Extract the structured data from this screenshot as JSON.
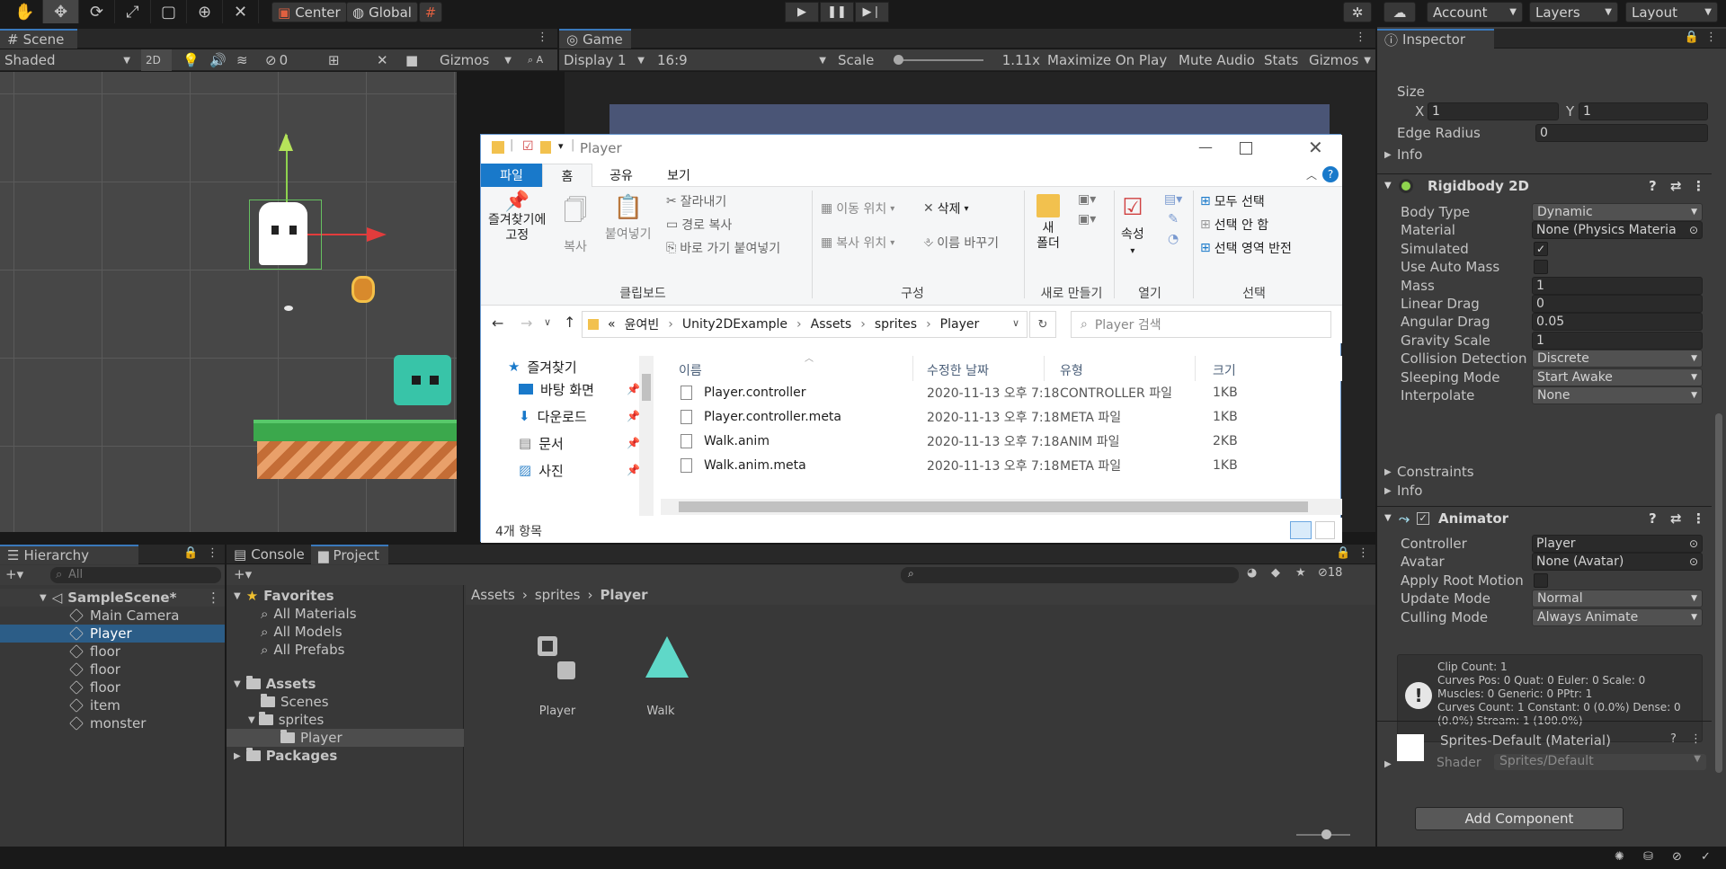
{
  "toolbar": {
    "tools": [
      "hand-tool-icon",
      "move-tool-icon",
      "rotate-tool-icon",
      "scale-tool-icon",
      "rect-tool-icon",
      "transform-tool-icon",
      "custom-tool-icon"
    ],
    "pivot": "Center",
    "space": "Global",
    "account": "Account",
    "layers": "Layers",
    "layout": "Layout"
  },
  "scene": {
    "tab": "Scene",
    "shading": "Shaded",
    "mode2d": "2D",
    "hidden_count": "0",
    "gizmos": "Gizmos"
  },
  "game": {
    "tab": "Game",
    "display": "Display 1",
    "aspect": "16:9",
    "scale_label": "Scale",
    "scale_value": "1.11x",
    "maximize": "Maximize On Play",
    "mute": "Mute Audio",
    "stats": "Stats",
    "gizmos": "Gizmos"
  },
  "hierarchy": {
    "tab": "Hierarchy",
    "search_placeholder": "All",
    "scene": "SampleScene*",
    "items": [
      "Main Camera",
      "Player",
      "floor",
      "floor",
      "floor",
      "item",
      "monster"
    ],
    "selected_index": 1
  },
  "project": {
    "tabs": [
      "Console",
      "Project"
    ],
    "favorites": "Favorites",
    "fav_items": [
      "All Materials",
      "All Models",
      "All Prefabs"
    ],
    "assets": "Assets",
    "asset_items": [
      "Scenes",
      "sprites"
    ],
    "sub_item": "Player",
    "packages": "Packages",
    "breadcrumb": [
      "Assets",
      "sprites",
      "Player"
    ],
    "files": [
      "Player",
      "Walk"
    ],
    "hidden_count": "18"
  },
  "inspector": {
    "tab": "Inspector",
    "size_label": "Size",
    "size_x_label": "X",
    "size_x": "1",
    "size_y_label": "Y",
    "size_y": "1",
    "edge_radius_label": "Edge Radius",
    "edge_radius": "0",
    "info": "Info",
    "rigidbody": {
      "title": "Rigidbody 2D",
      "rows": [
        {
          "label": "Body Type",
          "value": "Dynamic",
          "kind": "dd"
        },
        {
          "label": "Material",
          "value": "None (Physics Materia",
          "kind": "obj"
        },
        {
          "label": "Simulated",
          "value": "✓",
          "kind": "check"
        },
        {
          "label": "Use Auto Mass",
          "value": "",
          "kind": "check"
        },
        {
          "label": "Mass",
          "value": "1",
          "kind": "field"
        },
        {
          "label": "Linear Drag",
          "value": "0",
          "kind": "field"
        },
        {
          "label": "Angular Drag",
          "value": "0.05",
          "kind": "field"
        },
        {
          "label": "Gravity Scale",
          "value": "1",
          "kind": "field"
        },
        {
          "label": "Collision Detection",
          "value": "Discrete",
          "kind": "dd"
        },
        {
          "label": "Sleeping Mode",
          "value": "Start Awake",
          "kind": "dd"
        },
        {
          "label": "Interpolate",
          "value": "None",
          "kind": "dd"
        }
      ],
      "constraints": "Constraints",
      "info": "Info"
    },
    "animator": {
      "title": "Animator",
      "rows": [
        {
          "label": "Controller",
          "value": "Player",
          "kind": "obj"
        },
        {
          "label": "Avatar",
          "value": "None (Avatar)",
          "kind": "obj"
        },
        {
          "label": "Apply Root Motion",
          "value": "",
          "kind": "check"
        },
        {
          "label": "Update Mode",
          "value": "Normal",
          "kind": "dd"
        },
        {
          "label": "Culling Mode",
          "value": "Always Animate",
          "kind": "dd"
        }
      ],
      "info_lines": [
        "Clip Count: 1",
        "Curves Pos: 0 Quat: 0 Euler: 0 Scale: 0",
        "Muscles: 0 Generic: 0 PPtr: 1",
        "Curves Count: 1 Constant: 0 (0.0%) Dense: 0",
        "(0.0%) Stream: 1 (100.0%)"
      ]
    },
    "material": {
      "title": "Sprites-Default (Material)",
      "shader_label": "Shader",
      "shader": "Sprites/Default"
    },
    "add_component": "Add Component"
  },
  "explorer": {
    "title": "Player",
    "ribbon_tabs": [
      "파일",
      "홈",
      "공유",
      "보기"
    ],
    "clipboard": {
      "pin": "즐겨찾기에\n고정",
      "copy": "복사",
      "paste": "붙여넣기",
      "cut": "잘라내기",
      "copy_path": "경로 복사",
      "paste_shortcut": "바로 가기 붙여넣기",
      "group": "클립보드"
    },
    "organize": {
      "move_to": "이동 위치",
      "copy_to": "복사 위치",
      "delete": "삭제",
      "rename": "이름 바꾸기",
      "group": "구성"
    },
    "new": {
      "folder": "새\n폴더",
      "group": "새로 만들기"
    },
    "open": {
      "properties": "속성",
      "group": "열기"
    },
    "select": {
      "all": "모두 선택",
      "none": "선택 안 함",
      "invert": "선택 영역 반전",
      "group": "선택"
    },
    "path": [
      "«",
      "윤여빈",
      "Unity2DExample",
      "Assets",
      "sprites",
      "Player"
    ],
    "search_placeholder": "Player 검색",
    "nav": [
      "즐겨찾기",
      "바탕 화면",
      "다운로드",
      "문서",
      "사진"
    ],
    "columns": [
      "이름",
      "수정한 날짜",
      "유형",
      "크기"
    ],
    "files": [
      {
        "name": "Player.controller",
        "date": "2020-11-13 오후 7:18",
        "type": "CONTROLLER 파일",
        "size": "1KB"
      },
      {
        "name": "Player.controller.meta",
        "date": "2020-11-13 오후 7:18",
        "type": "META 파일",
        "size": "1KB"
      },
      {
        "name": "Walk.anim",
        "date": "2020-11-13 오후 7:18",
        "type": "ANIM 파일",
        "size": "2KB"
      },
      {
        "name": "Walk.anim.meta",
        "date": "2020-11-13 오후 7:18",
        "type": "META 파일",
        "size": "1KB"
      }
    ],
    "status": "4개 항목"
  },
  "colors": {
    "accent": "#3a79bb",
    "selection": "#2c5d87",
    "teal": "#5fd8c8"
  }
}
